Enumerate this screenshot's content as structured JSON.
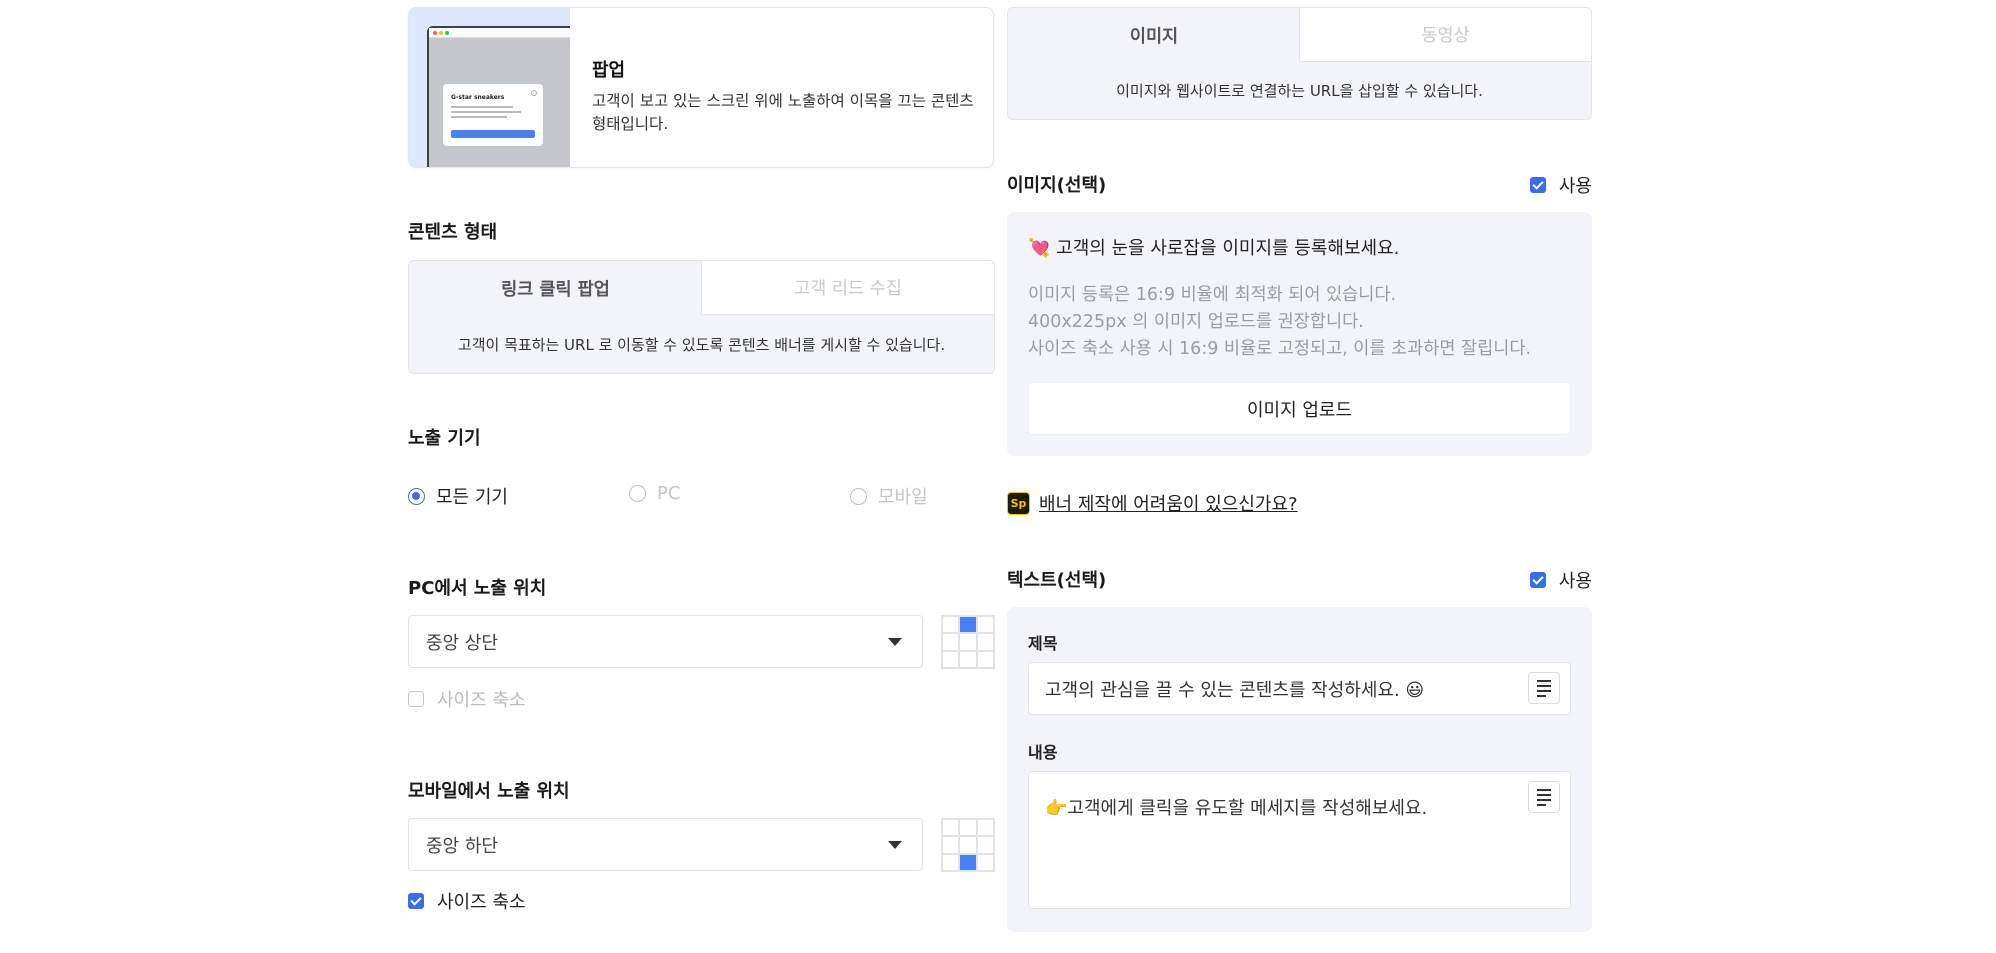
{
  "popup": {
    "title": "팝업",
    "description": "고객이 보고 있는 스크린 위에 노출하여 이목을 끄는 콘텐츠 형태입니다.",
    "preview_card_title": "G-star sneakers"
  },
  "content_type": {
    "label": "콘텐츠 형태",
    "tabs": [
      {
        "label": "링크 클릭 팝업",
        "active": true
      },
      {
        "label": "고객 리드 수집",
        "active": false
      }
    ],
    "description": "고객이 목표하는 URL 로 이동할 수 있도록 콘텐츠 배너를 게시할 수 있습니다."
  },
  "device": {
    "label": "노출 기기",
    "options": [
      {
        "label": "모든 기기",
        "selected": true
      },
      {
        "label": "PC",
        "selected": false
      },
      {
        "label": "모바일",
        "selected": false
      }
    ]
  },
  "pc_position": {
    "label": "PC에서 노출 위치",
    "value": "중앙 상단",
    "grid_selected": [
      0,
      1
    ],
    "shrink_label": "사이즈 축소",
    "shrink_checked": false
  },
  "mobile_position": {
    "label": "모바일에서 노출 위치",
    "value": "중앙 하단",
    "grid_selected": [
      2,
      1
    ],
    "shrink_label": "사이즈 축소",
    "shrink_checked": true
  },
  "media": {
    "tabs": [
      {
        "label": "이미지",
        "active": true
      },
      {
        "label": "동영상",
        "active": false
      }
    ],
    "description": "이미지와 웹사이트로 연결하는 URL을 삽입할 수 있습니다."
  },
  "image_section": {
    "label": "이미지(선택)",
    "use_label": "사용",
    "use_checked": true,
    "headline": "💘 고객의 눈을 사로잡을 이미지를 등록해보세요.",
    "notes": [
      "이미지 등록은 16:9 비율에 최적화 되어 있습니다.",
      "400x225px 의 이미지 업로드를 권장합니다.",
      "사이즈 축소 사용 시 16:9 비율로 고정되고, 이를 초과하면 잘립니다."
    ],
    "upload_label": "이미지 업로드"
  },
  "help": {
    "icon_text": "Sp",
    "link_text": "배너 제작에 어려움이 있으신가요?"
  },
  "text_section": {
    "label": "텍스트(선택)",
    "use_label": "사용",
    "use_checked": true,
    "title_label": "제목",
    "title_value": "고객의 관심을 끌 수 있는 콘텐츠를 작성하세요. 😃",
    "body_label": "내용",
    "body_value": "👉고객에게 클릭을 유도할 메세지를 작성해보세요."
  },
  "colors": {
    "accent": "#3a6ee8",
    "panel_bg": "#f3f4fa",
    "muted_text": "#9a9ca3"
  }
}
